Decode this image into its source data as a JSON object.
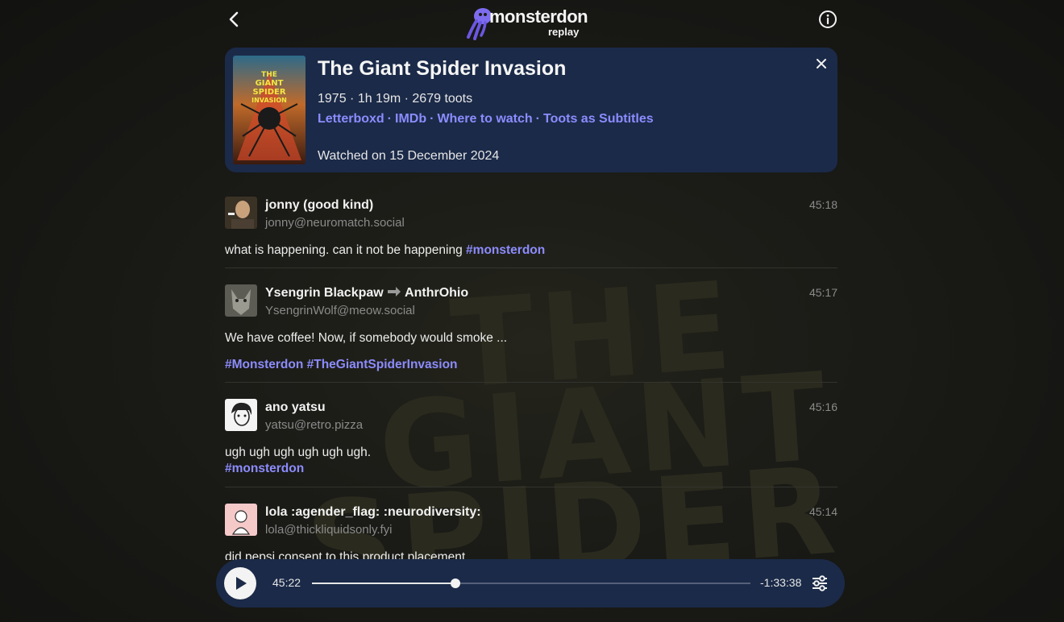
{
  "header": {
    "logo_text": "monsterdon",
    "logo_sub": "replay"
  },
  "movie": {
    "title": "The Giant Spider Invasion",
    "meta": "1975 · 1h 19m · 2679 toots",
    "links": [
      "Letterboxd",
      "IMDb",
      "Where to watch",
      "Toots as Subtitles"
    ],
    "watched": "Watched on 15 December 2024",
    "poster_text": "THE GIANT SPIDER INVASION"
  },
  "toots": [
    {
      "name": "jonny (good kind)",
      "handle": "jonny@neuromatch.social",
      "time": "45:18",
      "text": "what is happening. can it not be happening ",
      "hashtags": "#monsterdon"
    },
    {
      "name": "Ysengrin Blackpaw",
      "name_suffix": "AnthrOhio",
      "handle": "YsengrinWolf@meow.social",
      "time": "45:17",
      "text": "We have coffee! Now, if somebody would smoke ...",
      "hashtags": "#Monsterdon #TheGiantSpiderInvasion"
    },
    {
      "name": "ano yatsu",
      "handle": "yatsu@retro.pizza",
      "time": "45:16",
      "text": "ugh ugh ugh ugh ugh ugh.",
      "hashtags": "#monsterdon"
    },
    {
      "name": "lola :agender_flag: :neurodiversity:",
      "handle": "lola@thickliquidsonly.fyi",
      "time": "45:14",
      "text": "did pepsi consent to this product placement"
    }
  ],
  "player": {
    "elapsed": "45:22",
    "remaining": "-1:33:38",
    "progress": 0.327
  },
  "colors": {
    "accent": "#8c8cff",
    "card_bg": "#1b2a48",
    "page_bg": "#1b1b17"
  },
  "icons": [
    "back-arrow-icon",
    "info-icon",
    "close-icon",
    "play-icon",
    "settings-sliders-icon",
    "soon-arrow-icon"
  ]
}
